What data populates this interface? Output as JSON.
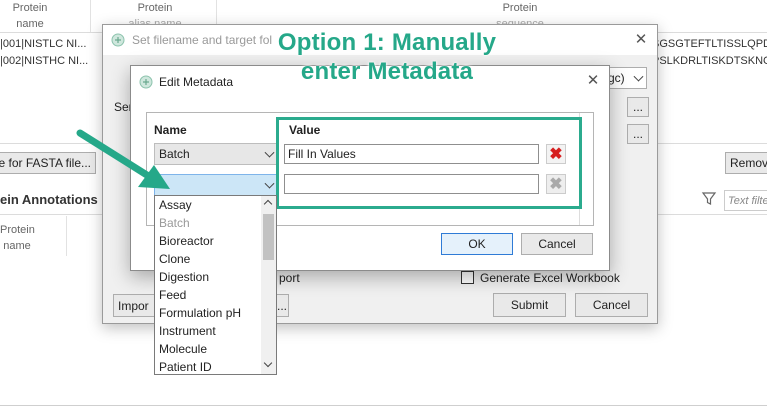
{
  "background": {
    "columns": {
      "protein_name": [
        "Protein",
        "name"
      ],
      "protein_alias": [
        "Protein",
        "alias name"
      ],
      "protein_sequence": [
        "Protein",
        "sequence"
      ]
    },
    "rows": [
      {
        "name": "|001|NISTLC NI...",
        "sequence": "SGSGTEFTLTISSLQPD"
      },
      {
        "name": "|002|NISTHC NI...",
        "sequence": "PSLKDRLTISKDTSKNC"
      }
    ],
    "fasta_button": "se for FASTA file...",
    "remove_button": "Remov",
    "annotations_title": "ein Annotations",
    "annotations_column": [
      "Protein",
      "name"
    ],
    "filter_placeholder": "Text filte"
  },
  "parent_dialog": {
    "title": "Set filename and target fol",
    "side_label": "Ser",
    "combo_tail": "gc)",
    "browse_label": "...",
    "import_label": "Impor",
    "port_label": "port",
    "generate_excel_label": "Generate Excel Workbook",
    "submit_label": "Submit",
    "cancel_label": "Cancel"
  },
  "edit_metadata": {
    "title": "Edit Metadata",
    "name_header": "Name",
    "value_header": "Value",
    "rows": [
      {
        "name": "Batch",
        "value": "Fill In Values"
      },
      {
        "name": "",
        "value": ""
      }
    ],
    "ok_label": "OK",
    "cancel_label": "Cancel"
  },
  "dropdown": {
    "items": [
      {
        "label": "Assay",
        "enabled": true
      },
      {
        "label": "Batch",
        "enabled": false
      },
      {
        "label": "Bioreactor",
        "enabled": true
      },
      {
        "label": "Clone",
        "enabled": true
      },
      {
        "label": "Digestion",
        "enabled": true
      },
      {
        "label": "Feed",
        "enabled": true
      },
      {
        "label": "Formulation pH",
        "enabled": true
      },
      {
        "label": "Instrument",
        "enabled": true
      },
      {
        "label": "Molecule",
        "enabled": true
      },
      {
        "label": "Patient ID",
        "enabled": true
      }
    ]
  },
  "annotation": {
    "line1": "Option 1: Manually",
    "line2": "enter Metadata"
  },
  "colors": {
    "accent_teal": "#25a889",
    "annotation_box": "#2bab8e",
    "selected_combo": "#cce6f7",
    "delete_red": "#d62020",
    "ok_border": "#2f7bd6"
  },
  "icons": {
    "app": "app-logo-icon",
    "close": "close-icon",
    "delete": "delete-icon",
    "filter": "filter-icon",
    "dropdown": "chevron-down-icon",
    "pointer": "arrow-pointer-icon"
  }
}
